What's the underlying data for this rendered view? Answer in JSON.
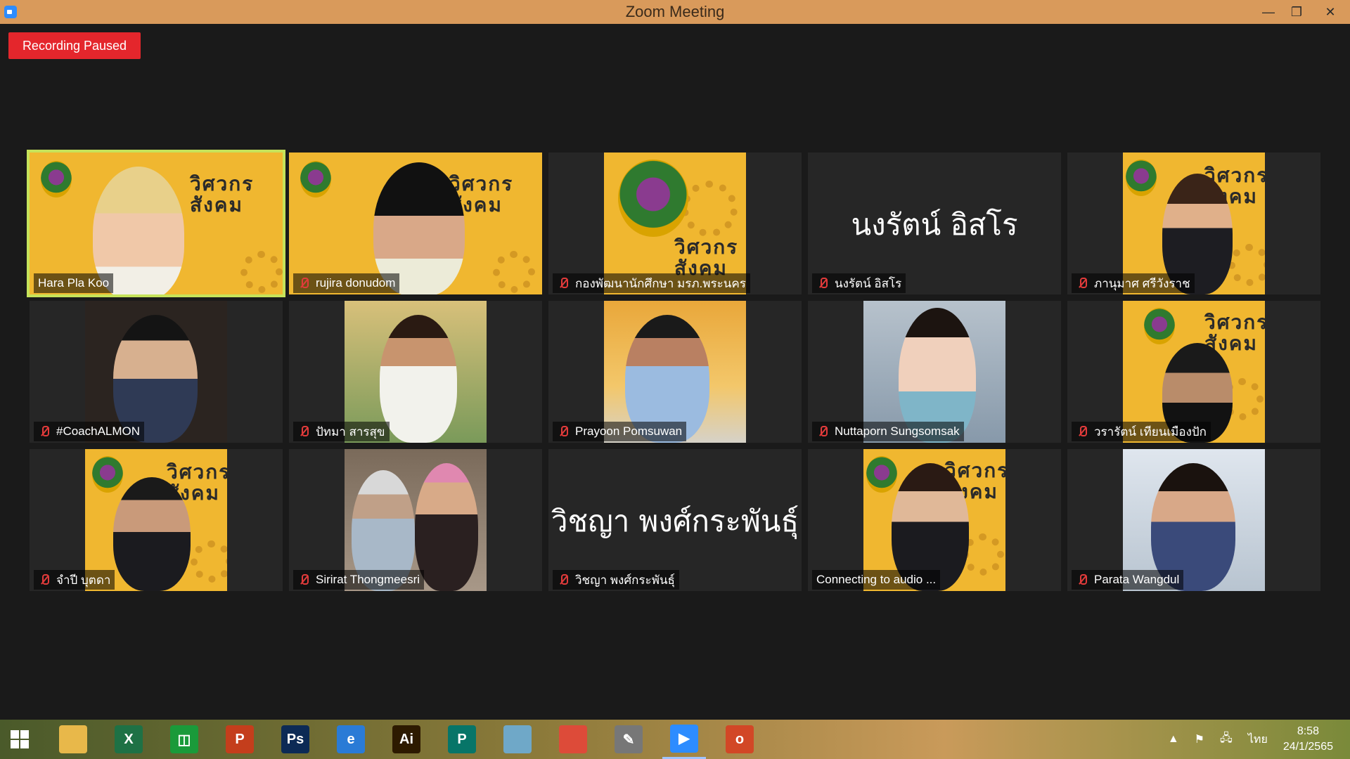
{
  "window": {
    "title": "Zoom Meeting",
    "minimize_glyph": "—",
    "restore_glyph": "❐",
    "close_glyph": "✕"
  },
  "recording": {
    "label": "Recording Paused"
  },
  "participants": [
    {
      "name": "Hara Pla Koo",
      "muted": false
    },
    {
      "name": "rujira donudom",
      "muted": true
    },
    {
      "name": "กองพัฒนานักศึกษา มรภ.พระนคร",
      "muted": true
    },
    {
      "name": "นงรัตน์ อิสโร",
      "muted": true,
      "display_text": "นงรัตน์ อิสโร"
    },
    {
      "name": "ภานุมาศ ศรีวังราช",
      "muted": true
    },
    {
      "name": "#CoachALMON",
      "muted": true
    },
    {
      "name": "ปัทมา สารสุข",
      "muted": true
    },
    {
      "name": "Prayoon Pomsuwan",
      "muted": true
    },
    {
      "name": "Nuttaporn Sungsomsak",
      "muted": true
    },
    {
      "name": "วรารัตน์ เทียนเมืองปัก",
      "muted": true
    },
    {
      "name": "จำปี บุตดา",
      "muted": true
    },
    {
      "name": "Sirirat Thongmeesri",
      "muted": true
    },
    {
      "name": "วิชญา พงศ์กระพันธุ์",
      "muted": true,
      "display_text": "วิชญา พงศ์กระพันธุ์"
    },
    {
      "name": "Connecting to audio ...",
      "muted": false
    },
    {
      "name": "Parata Wangdul",
      "muted": true
    }
  ],
  "background_text": {
    "line1": "วิศวกร",
    "line2": "สังคม"
  },
  "taskbar": {
    "apps": [
      {
        "name": "file-explorer",
        "glyph": "",
        "color": "#e8b84a"
      },
      {
        "name": "excel",
        "glyph": "X",
        "color": "#1e7145"
      },
      {
        "name": "store",
        "glyph": "◫",
        "color": "#1a9a3a"
      },
      {
        "name": "powerpoint",
        "glyph": "P",
        "color": "#c43e1c"
      },
      {
        "name": "photoshop",
        "glyph": "Ps",
        "color": "#0c2a55"
      },
      {
        "name": "internet-explorer",
        "glyph": "e",
        "color": "#2a7bd6"
      },
      {
        "name": "illustrator",
        "glyph": "Ai",
        "color": "#2d1a00"
      },
      {
        "name": "publisher",
        "glyph": "P",
        "color": "#077568"
      },
      {
        "name": "notes",
        "glyph": "",
        "color": "#6fa8c8"
      },
      {
        "name": "chrome",
        "glyph": "",
        "color": "#dd4b39"
      },
      {
        "name": "pen-tool",
        "glyph": "✎",
        "color": "#777777"
      },
      {
        "name": "zoom",
        "glyph": "▶",
        "color": "#2d8cff"
      },
      {
        "name": "powerpoint-viewer",
        "glyph": "o",
        "color": "#d24726"
      }
    ],
    "language": "ไทย",
    "time": "8:58",
    "date": "24/1/2565"
  }
}
